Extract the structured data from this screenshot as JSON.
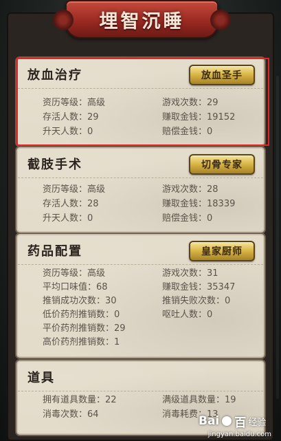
{
  "title": "埋智沉睡",
  "sections": [
    {
      "title": "放血治疗",
      "badge": "放血圣手",
      "stats": [
        {
          "label": "资历等级：",
          "value": "高级"
        },
        {
          "label": "游戏次数：",
          "value": "29"
        },
        {
          "label": "存活人数：",
          "value": "29"
        },
        {
          "label": "赚取金钱：",
          "value": "19152"
        },
        {
          "label": "升天人数：",
          "value": "0"
        },
        {
          "label": "赔偿金钱：",
          "value": "0"
        }
      ]
    },
    {
      "title": "截肢手术",
      "badge": "切骨专家",
      "stats": [
        {
          "label": "资历等级：",
          "value": "高级"
        },
        {
          "label": "游戏次数：",
          "value": "28"
        },
        {
          "label": "存活人数：",
          "value": "28"
        },
        {
          "label": "赚取金钱：",
          "value": "18339"
        },
        {
          "label": "升天人数：",
          "value": "0"
        },
        {
          "label": "赔偿金钱：",
          "value": "0"
        }
      ]
    },
    {
      "title": "药品配置",
      "badge": "皇家厨师",
      "stats": [
        {
          "label": "资历等级：",
          "value": "高级"
        },
        {
          "label": "游戏次数：",
          "value": "31"
        },
        {
          "label": "平均口味值：",
          "value": "68"
        },
        {
          "label": "赚取金钱：",
          "value": "35347"
        },
        {
          "label": "推销成功次数：",
          "value": "30"
        },
        {
          "label": "推销失败次数：",
          "value": "0"
        },
        {
          "label": "低价药剂推销数：",
          "value": "0"
        },
        {
          "label": "呕吐人数：",
          "value": "0"
        },
        {
          "label": "平价药剂推销数：",
          "value": "29"
        },
        {
          "label": "高价药剂推销数：",
          "value": "1"
        }
      ]
    },
    {
      "title": "道具",
      "stats": [
        {
          "label": "拥有道具数量：",
          "value": "22"
        },
        {
          "label": "满级道具数量：",
          "value": "19"
        },
        {
          "label": "消毒次数：",
          "value": "64"
        },
        {
          "label": "消毒耗费：",
          "value": "13"
        }
      ]
    }
  ],
  "watermark": {
    "logo": "Bai",
    "logo2": "百",
    "cn": "经验",
    "url": "jingyan.baidu.com"
  },
  "colors": {
    "highlight": "#e12525",
    "title_plaque": "#9a2a22",
    "badge_gold": "#d7b443"
  }
}
